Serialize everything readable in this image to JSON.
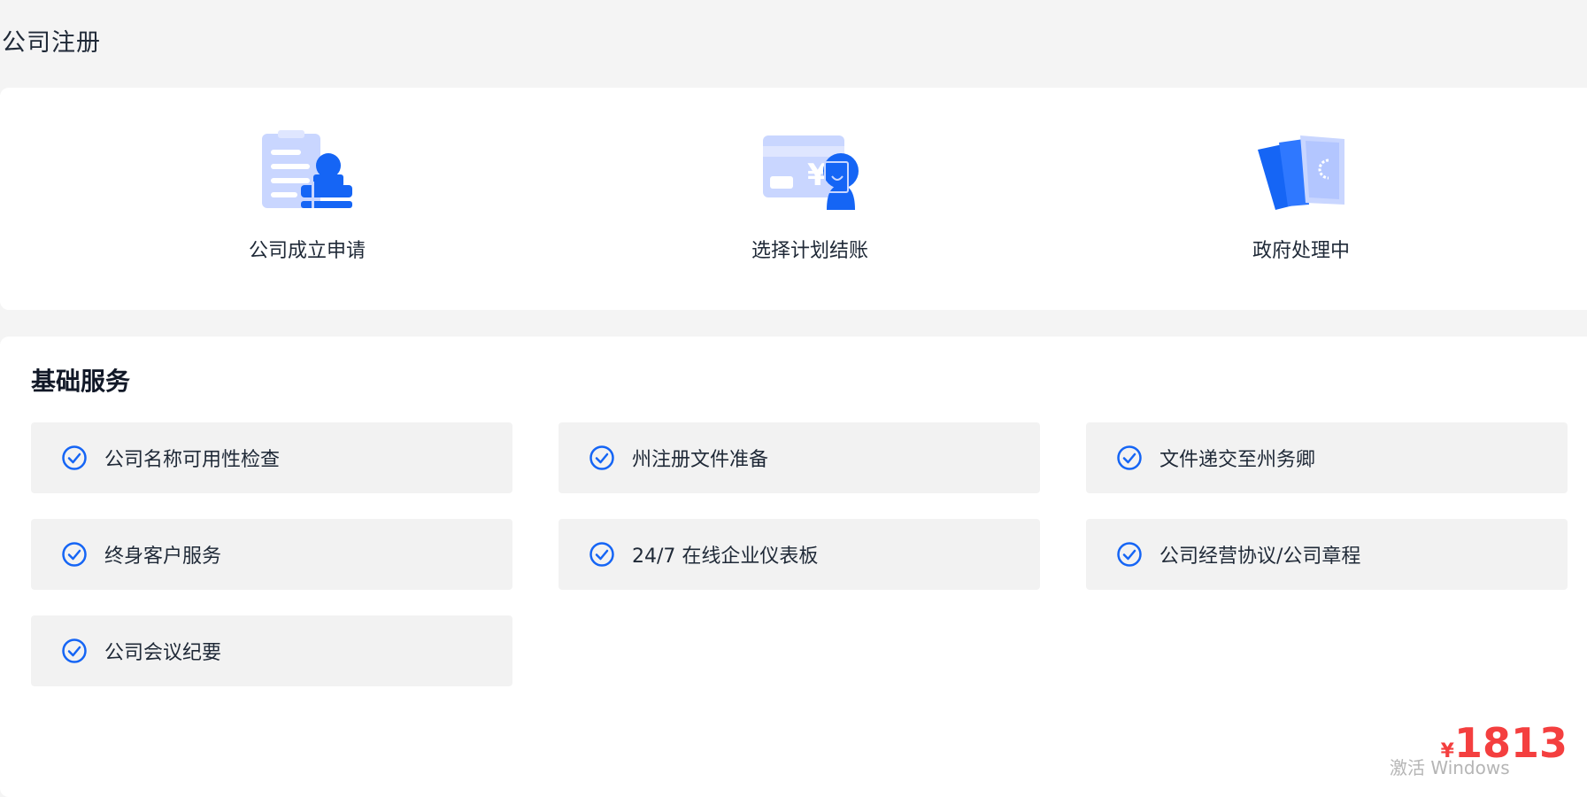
{
  "page": {
    "title": "公司注册"
  },
  "steps": [
    {
      "label": "公司成立申请",
      "icon": "application-form-icon"
    },
    {
      "label": "选择计划结账",
      "icon": "payment-card-icon"
    },
    {
      "label": "政府处理中",
      "icon": "documents-processing-icon"
    }
  ],
  "services": {
    "title": "基础服务",
    "items": [
      "公司名称可用性检查",
      "州注册文件准备",
      "文件递交至州务卿",
      "终身客户服务",
      "24/7 在线企业仪表板",
      "公司经营协议/公司章程",
      "公司会议纪要"
    ]
  },
  "price": {
    "currency": "¥",
    "amount": "1813"
  },
  "watermark": "激活 Windows",
  "colors": {
    "accent": "#1565f5",
    "accent_light": "#c9d6ff",
    "price": "#f43f3f"
  }
}
